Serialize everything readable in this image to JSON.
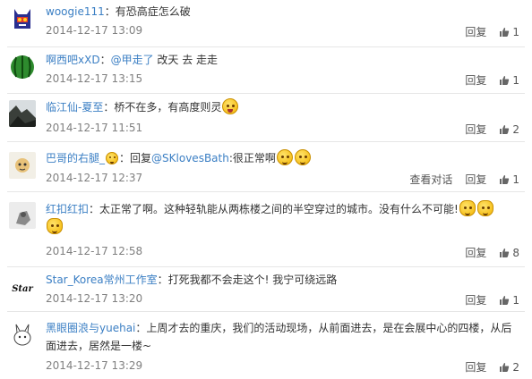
{
  "comments": [
    {
      "user": "woogie111",
      "colon": "：",
      "text": "有恐高症怎么破",
      "time": "2014-12-17 13:09",
      "reply_label": "回复",
      "likes": "1"
    },
    {
      "user": "啊西吧xXD",
      "colon": "：",
      "mention": "@甲走了",
      "text": " 改天 去 走走",
      "time": "2014-12-17 13:15",
      "reply_label": "回复",
      "likes": "1"
    },
    {
      "user": "临江仙-夏至",
      "colon": "：",
      "text": "桥不在多，有高度则灵",
      "time": "2014-12-17 11:51",
      "reply_label": "回复",
      "likes": "2"
    },
    {
      "user": "巴哥的右腿_",
      "colon": "：",
      "text_prefix": "回复",
      "mention": "@SKlovesBath",
      "text": ":很正常啊",
      "time": "2014-12-17 12:37",
      "view_conversation_label": "查看对话",
      "reply_label": "回复",
      "likes": "1"
    },
    {
      "user": "红扣红扣",
      "colon": "：",
      "text": "太正常了啊。这种轻轨能从两栋楼之间的半空穿过的城市。没有什么不可能!",
      "time": "2014-12-17 12:58",
      "reply_label": "回复",
      "likes": "8"
    },
    {
      "user": "Star_Korea常州工作室",
      "colon": "：",
      "text": "打死我都不会走这个! 我宁可绕远路",
      "avatar_text": "Star",
      "time": "2014-12-17 13:20",
      "reply_label": "回复",
      "likes": "1"
    },
    {
      "user": "黑眼圈浪与yuehai",
      "colon": "：",
      "text": "上周才去的重庆，我们的活动现场，从前面进去，是在会展中心的四楼，从后面进去，居然是一楼~",
      "time": "2014-12-17 13:29",
      "reply_label": "回复",
      "likes": "2"
    }
  ]
}
